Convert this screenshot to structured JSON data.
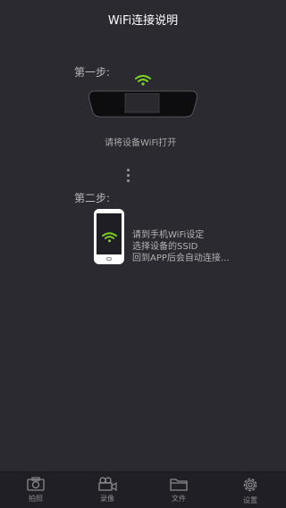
{
  "header": {
    "title": "WiFi连接说明"
  },
  "step1": {
    "label": "第一步:",
    "instruction": "请将设备WiFi打开"
  },
  "step2": {
    "label": "第二步:",
    "instruction_lines": "请到手机WiFi设定\n选择设备的SSID\n回到APP后会自动连接..."
  },
  "tabs": [
    {
      "label": "拍照",
      "icon": "camera-icon"
    },
    {
      "label": "录像",
      "icon": "video-camera-icon"
    },
    {
      "label": "文件",
      "icon": "folder-icon"
    },
    {
      "label": "设置",
      "icon": "gear-icon"
    }
  ],
  "colors": {
    "background": "#2b2a31",
    "wifi_green": "#7ed321",
    "tabbar": "#211f26"
  }
}
